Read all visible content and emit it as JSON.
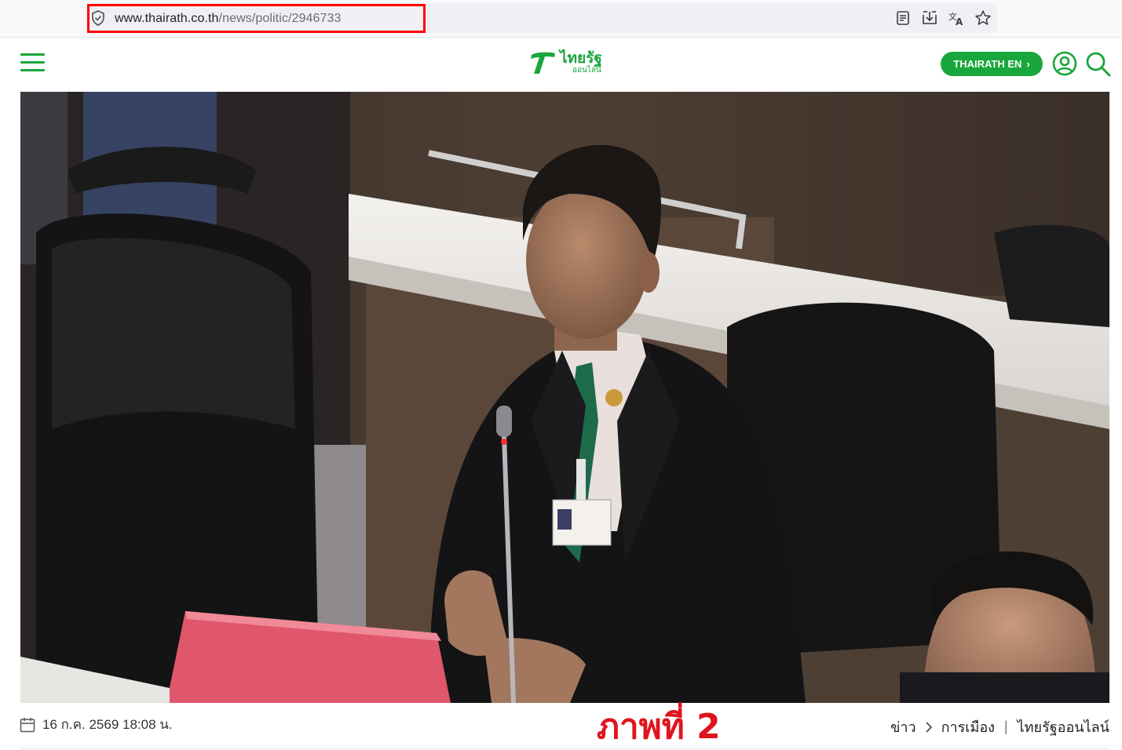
{
  "browser": {
    "url_host": "www.thairath.co.th",
    "url_path": "/news/politic/2946733",
    "icons": [
      "reader-view-icon",
      "download-icon",
      "translate-icon",
      "bookmark-star-icon"
    ]
  },
  "header": {
    "logo_main": "ไทยรัฐ",
    "logo_sub": "ออนไลน์",
    "en_button_label": "THAIRATH EN",
    "en_button_chevron": "›",
    "brand_color": "#19a63c"
  },
  "article": {
    "date": "16 ก.ค. 2569 18:08 น.",
    "caption_overlay": "ภาพที่ 2",
    "breadcrumb": {
      "home": "ข่าว",
      "section": "การเมือง",
      "source": "ไทยรัฐออนไลน์"
    }
  },
  "annotation": {
    "highlight_color": "#ff0000"
  }
}
